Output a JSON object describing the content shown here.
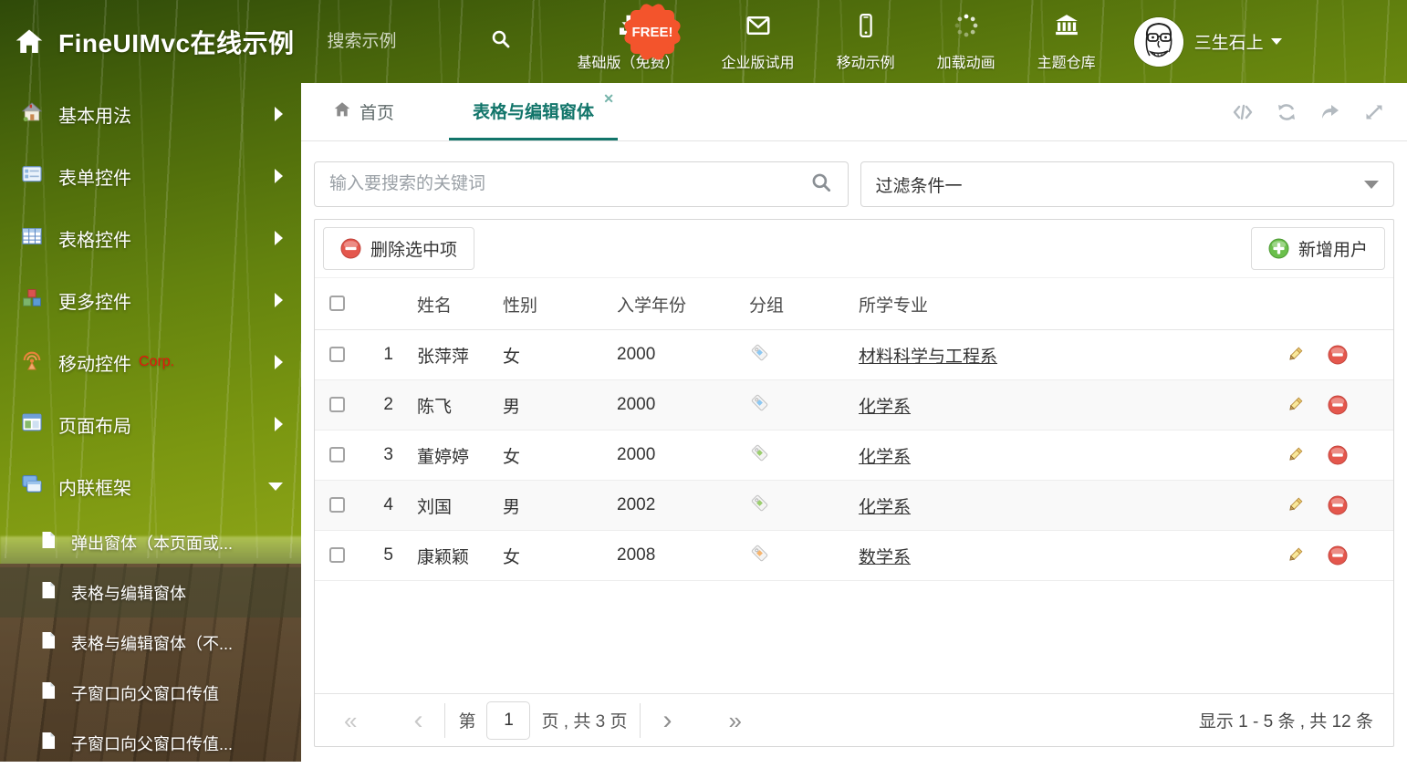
{
  "header": {
    "title": "FineUIMvc在线示例",
    "search_placeholder": "搜索示例",
    "free_badge": "FREE!",
    "nav": [
      {
        "label": "基础版（免费）"
      },
      {
        "label": "企业版试用"
      },
      {
        "label": "移动示例"
      },
      {
        "label": "加载动画"
      },
      {
        "label": "主题仓库"
      }
    ],
    "username": "三生石上"
  },
  "sidebar": {
    "items": [
      {
        "label": "基本用法"
      },
      {
        "label": "表单控件"
      },
      {
        "label": "表格控件"
      },
      {
        "label": "更多控件"
      },
      {
        "label": "移动控件",
        "badge": "Corp."
      },
      {
        "label": "页面布局"
      },
      {
        "label": "内联框架"
      }
    ],
    "subitems": [
      {
        "label": "弹出窗体（本页面或..."
      },
      {
        "label": "表格与编辑窗体"
      },
      {
        "label": "表格与编辑窗体（不..."
      },
      {
        "label": "子窗口向父窗口传值"
      },
      {
        "label": "子窗口向父窗口传值..."
      }
    ]
  },
  "tabs": [
    {
      "label": "首页"
    },
    {
      "label": "表格与编辑窗体"
    }
  ],
  "filter_bar": {
    "search_placeholder": "输入要搜索的关键词",
    "filter_selected": "过滤条件一"
  },
  "grid": {
    "delete_button": "删除选中项",
    "add_button": "新增用户",
    "columns": {
      "name": "姓名",
      "gender": "性别",
      "year": "入学年份",
      "group": "分组",
      "major": "所学专业"
    },
    "rows": [
      {
        "index": "1",
        "name": "张萍萍",
        "gender": "女",
        "year": "2000",
        "tag_color": "#8cc8f3",
        "major": "材料科学与工程系"
      },
      {
        "index": "2",
        "name": "陈飞",
        "gender": "男",
        "year": "2000",
        "tag_color": "#8cc8f3",
        "major": "化学系"
      },
      {
        "index": "3",
        "name": "董婷婷",
        "gender": "女",
        "year": "2000",
        "tag_color": "#9bce6d",
        "major": "化学系"
      },
      {
        "index": "4",
        "name": "刘国",
        "gender": "男",
        "year": "2002",
        "tag_color": "#9bce6d",
        "major": "化学系"
      },
      {
        "index": "5",
        "name": "康颖颖",
        "gender": "女",
        "year": "2008",
        "tag_color": "#f6b46d",
        "major": "数学系"
      }
    ]
  },
  "pagination": {
    "prefix": "第",
    "page_value": "1",
    "suffix": "页 , 共 3 页",
    "summary": "显示 1 - 5 条 , 共 12 条"
  },
  "colors": {
    "accent": "#12756a",
    "free_badge": "#f3542c"
  }
}
